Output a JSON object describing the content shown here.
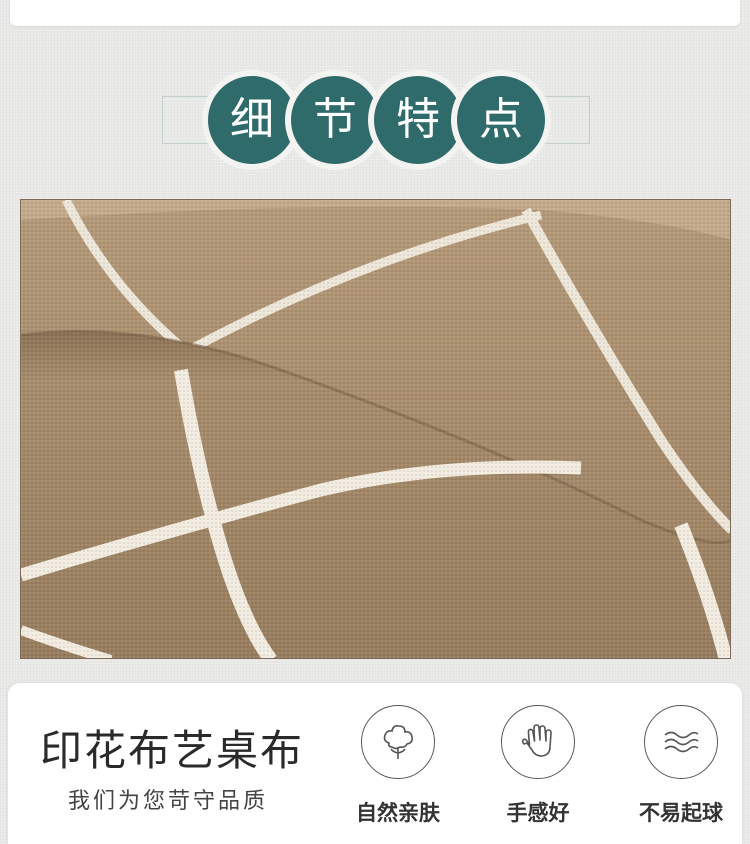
{
  "heading": {
    "chars": [
      "细",
      "节",
      "特",
      "点"
    ],
    "circle_color": "#2f6b6a"
  },
  "photo": {
    "subject": "fabric-closeup",
    "fabric_color": "#a08566",
    "line_color": "#f2ece1"
  },
  "product": {
    "title": "印花布艺桌布",
    "slogan": "我们为您苛守品质"
  },
  "features": [
    {
      "icon": "cotton-icon",
      "label": "自然亲肤"
    },
    {
      "icon": "hand-icon",
      "label": "手感好"
    },
    {
      "icon": "wave-icon",
      "label": "不易起球"
    }
  ]
}
